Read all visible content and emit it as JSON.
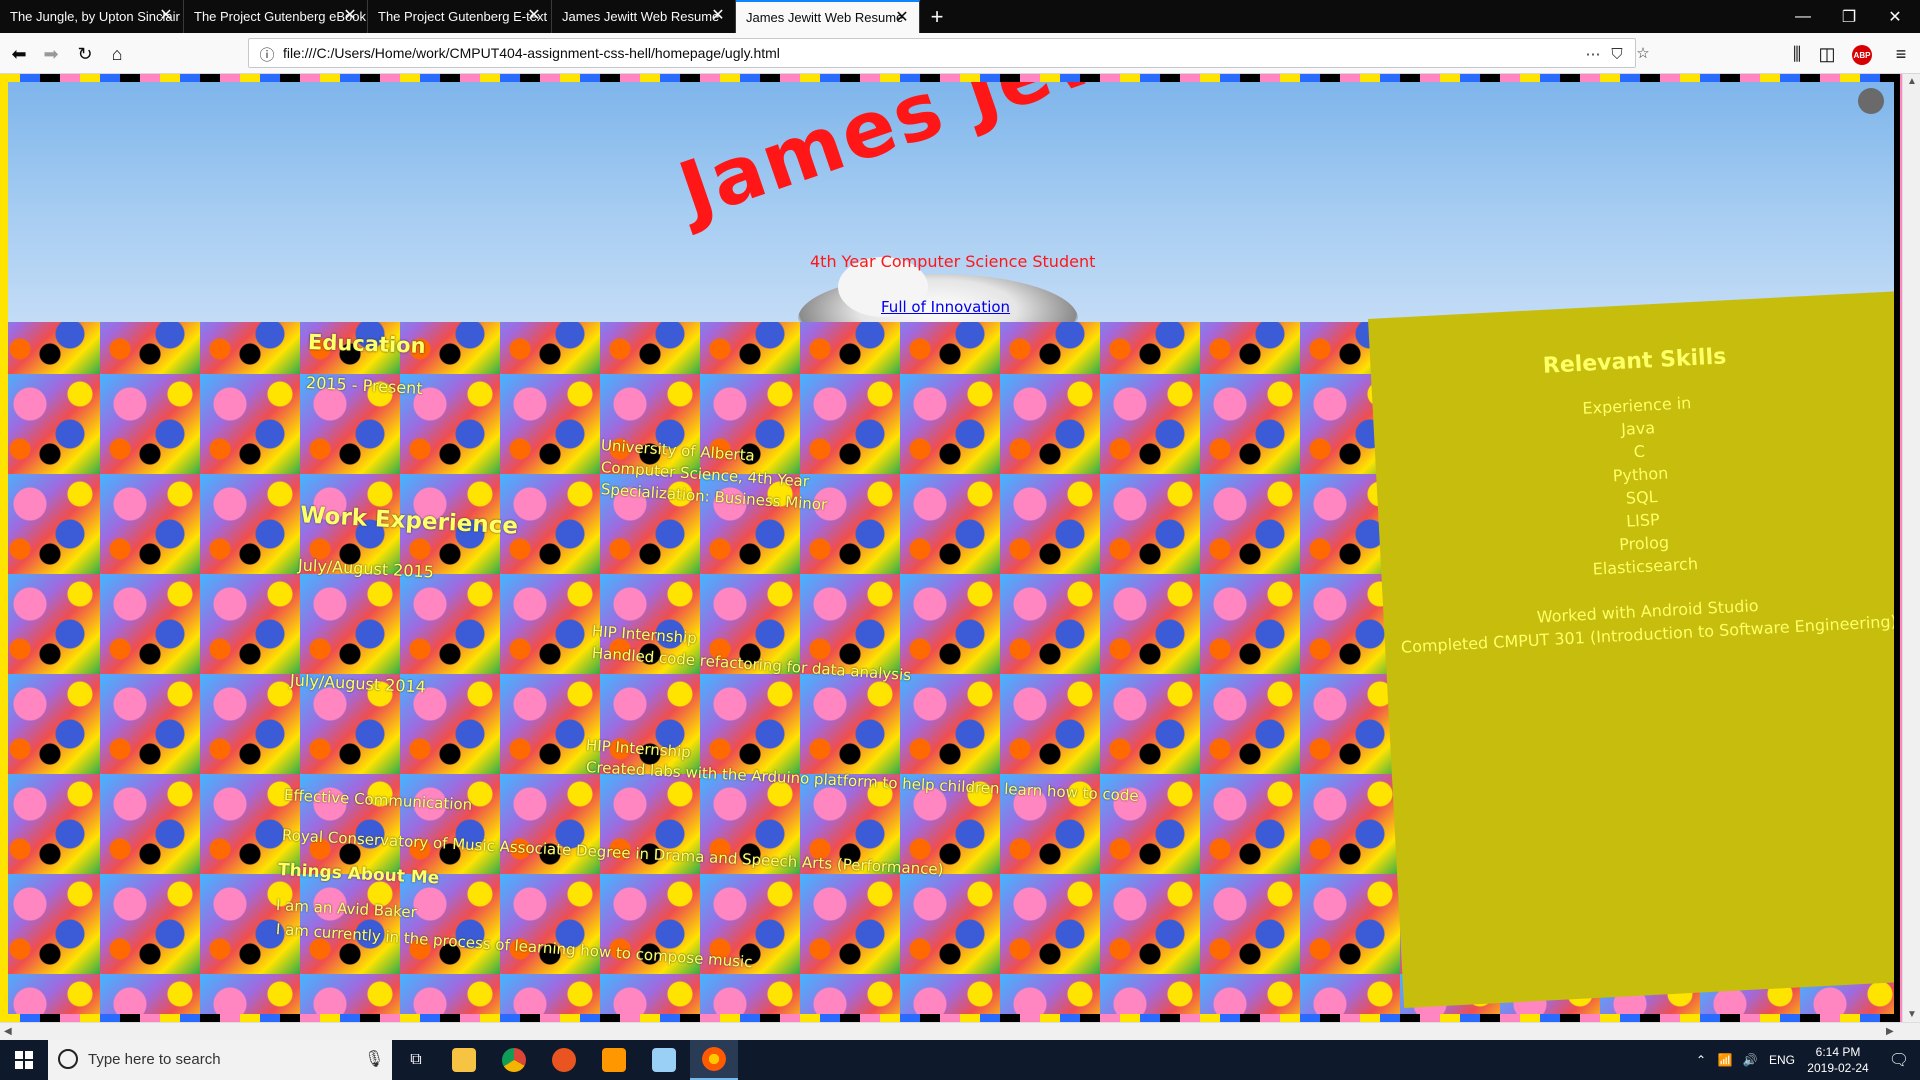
{
  "browser": {
    "tabs": [
      {
        "label": "The Jungle, by Upton Sinclair",
        "active": false
      },
      {
        "label": "The Project Gutenberg eBook of Dr",
        "active": false
      },
      {
        "label": "The Project Gutenberg E-text of Ol",
        "active": false
      },
      {
        "label": "James Jewitt Web Resume",
        "active": false
      },
      {
        "label": "James Jewitt Web Resume",
        "active": true
      }
    ],
    "url": "file:///C:/Users/Home/work/CMPUT404-assignment-css-hell/homepage/ugly.html",
    "abp_label": "ABP"
  },
  "page": {
    "name": "James Jewitt",
    "subtitle": "4th Year Computer Science Student",
    "tagline": "Full of Innovation",
    "education": {
      "heading": "Education",
      "date": "2015 - Present",
      "lines": [
        "University of Alberta",
        "Computer Science, 4th Year",
        "Specialization: Business Minor"
      ]
    },
    "work": {
      "heading": "Work Experience",
      "jobs": [
        {
          "date": "July/August 2015",
          "title": "HIP Internship",
          "desc": "Handled code refactoring for data analysis"
        },
        {
          "date": "July/August 2014",
          "title": "HIP Internship",
          "desc": "Created labs with the Arduino platform to help children learn how to code"
        }
      ]
    },
    "extras": [
      "Effective Communication",
      "Royal Conservatory of Music Associate Degree in Drama and Speech Arts (Performance)"
    ],
    "about": {
      "heading": "Things About Me",
      "lines": [
        "I am an Avid Baker",
        "I am currently in the process of learning how to compose music"
      ]
    },
    "skills": {
      "heading": "Relevant Skills",
      "intro": "Experience in",
      "items": [
        "Java",
        "C",
        "Python",
        "SQL",
        "LISP",
        "Prolog",
        "Elasticsearch"
      ],
      "notes": [
        "Worked with Android Studio",
        "Completed CMPUT 301 (Introduction to Software Engineering)"
      ]
    }
  },
  "taskbar": {
    "search_placeholder": "Type here to search",
    "lang": "ENG",
    "time": "6:14 PM",
    "date": "2019-02-24"
  },
  "colors": {
    "name_red": "#ff1717",
    "text_yellow": "#ffff66",
    "skills_panel": "#c6bd0d",
    "link_blue": "#0000ee"
  }
}
